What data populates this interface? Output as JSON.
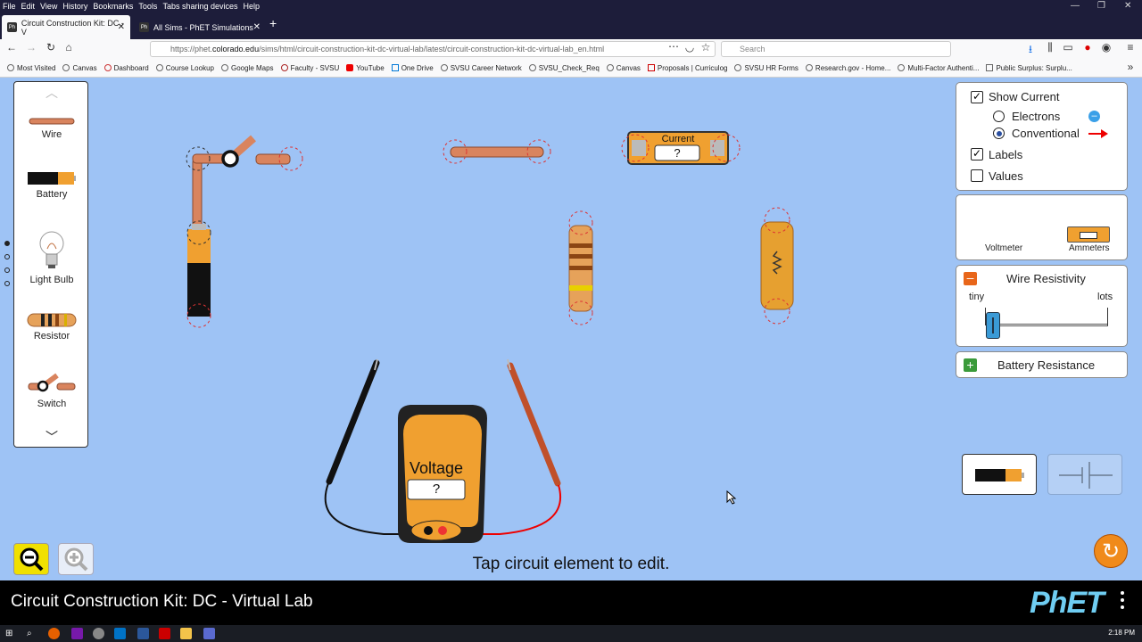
{
  "browser": {
    "menu": [
      "File",
      "Edit",
      "View",
      "History",
      "Bookmarks",
      "Tools",
      "Tabs sharing devices",
      "Help"
    ],
    "tabs": [
      {
        "label": "Circuit Construction Kit: DC - V",
        "active": true
      },
      {
        "label": "All Sims - PhET Simulations",
        "active": false
      }
    ],
    "url_prefix": "https://phet.",
    "url_domain": "colorado.edu",
    "url_rest": "/sims/html/circuit-construction-kit-dc-virtual-lab/latest/circuit-construction-kit-dc-virtual-lab_en.html",
    "search_placeholder": "Search",
    "bookmarks": [
      "Most Visited",
      "Canvas",
      "Dashboard",
      "Course Lookup",
      "Google Maps",
      "Faculty - SVSU",
      "YouTube",
      "One Drive",
      "SVSU Career Network",
      "SVSU_Check_Req",
      "Canvas",
      "Proposals | Curriculog",
      "SVSU HR Forms",
      "Research.gov - Home...",
      "Multi-Factor Authenti...",
      "Public Surplus: Surplu..."
    ]
  },
  "toolbox": {
    "items": [
      {
        "label": "Wire",
        "icon": "wire-icon"
      },
      {
        "label": "Battery",
        "icon": "battery-icon"
      },
      {
        "label": "Light Bulb",
        "icon": "light-bulb-icon"
      },
      {
        "label": "Resistor",
        "icon": "resistor-icon"
      },
      {
        "label": "Switch",
        "icon": "switch-icon"
      }
    ]
  },
  "controls": {
    "show_current": {
      "label": "Show Current",
      "checked": true
    },
    "electrons": {
      "label": "Electrons",
      "selected": false
    },
    "conventional": {
      "label": "Conventional",
      "selected": true
    },
    "labels": {
      "label": "Labels",
      "checked": true
    },
    "values": {
      "label": "Values",
      "checked": false
    }
  },
  "sensors": {
    "voltmeter": "Voltmeter",
    "ammeters": "Ammeters"
  },
  "wire_resistivity": {
    "title": "Wire Resistivity",
    "min_label": "tiny",
    "max_label": "lots",
    "level": 0.03
  },
  "battery_resistance": {
    "title": "Battery Resistance"
  },
  "ammeter": {
    "title": "Current",
    "value": "?"
  },
  "voltmeter": {
    "title": "Voltage",
    "value": "?"
  },
  "status_message": "Tap circuit element to edit.",
  "footer": {
    "title": "Circuit Construction Kit: DC - Virtual Lab",
    "logo": "PhET"
  },
  "taskbar": {
    "clock": "2:18 PM"
  },
  "colors": {
    "background": "#9ec3f5",
    "copper": "#d9845e",
    "battery_orange": "#f0a030",
    "phet_blue": "#6fcdf2"
  }
}
